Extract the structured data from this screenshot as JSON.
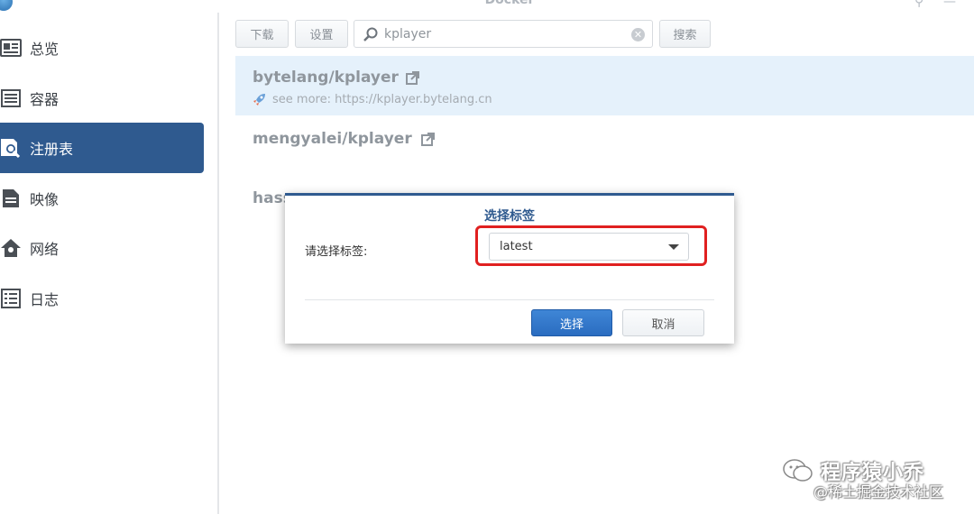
{
  "window": {
    "title": "Docker",
    "controls": [
      "pin-icon",
      "minimize-icon"
    ]
  },
  "sidebar": {
    "items": [
      {
        "label": "总览",
        "icon": "overview-icon",
        "active": false
      },
      {
        "label": "容器",
        "icon": "container-icon",
        "active": false
      },
      {
        "label": "注册表",
        "icon": "registry-search-icon",
        "active": true
      },
      {
        "label": "映像",
        "icon": "image-icon",
        "active": false
      },
      {
        "label": "网络",
        "icon": "network-icon",
        "active": false
      },
      {
        "label": "日志",
        "icon": "log-icon",
        "active": false
      }
    ]
  },
  "toolbar": {
    "download_label": "下载",
    "settings_label": "设置",
    "search_value": "kplayer",
    "search_button_label": "搜索"
  },
  "results": [
    {
      "name": "bytelang/kplayer",
      "description": "see more: https://kplayer.bytelang.cn",
      "selected": true
    },
    {
      "name": "mengyalei/kplayer",
      "description": "",
      "selected": false
    },
    {
      "name": "hass",
      "description": "",
      "selected": false
    }
  ],
  "dialog": {
    "title": "选择标签",
    "label": "请选择标签:",
    "selected_tag": "latest",
    "confirm_label": "选择",
    "cancel_label": "取消"
  },
  "watermark": {
    "line1": "程序猿小乔",
    "line2": "@稀土掘金技术社区"
  },
  "colors": {
    "accent": "#2f5a8f",
    "primary_button": "#2a6cc0",
    "selected_row": "#e5f1fb",
    "highlight_box": "#e02020"
  }
}
